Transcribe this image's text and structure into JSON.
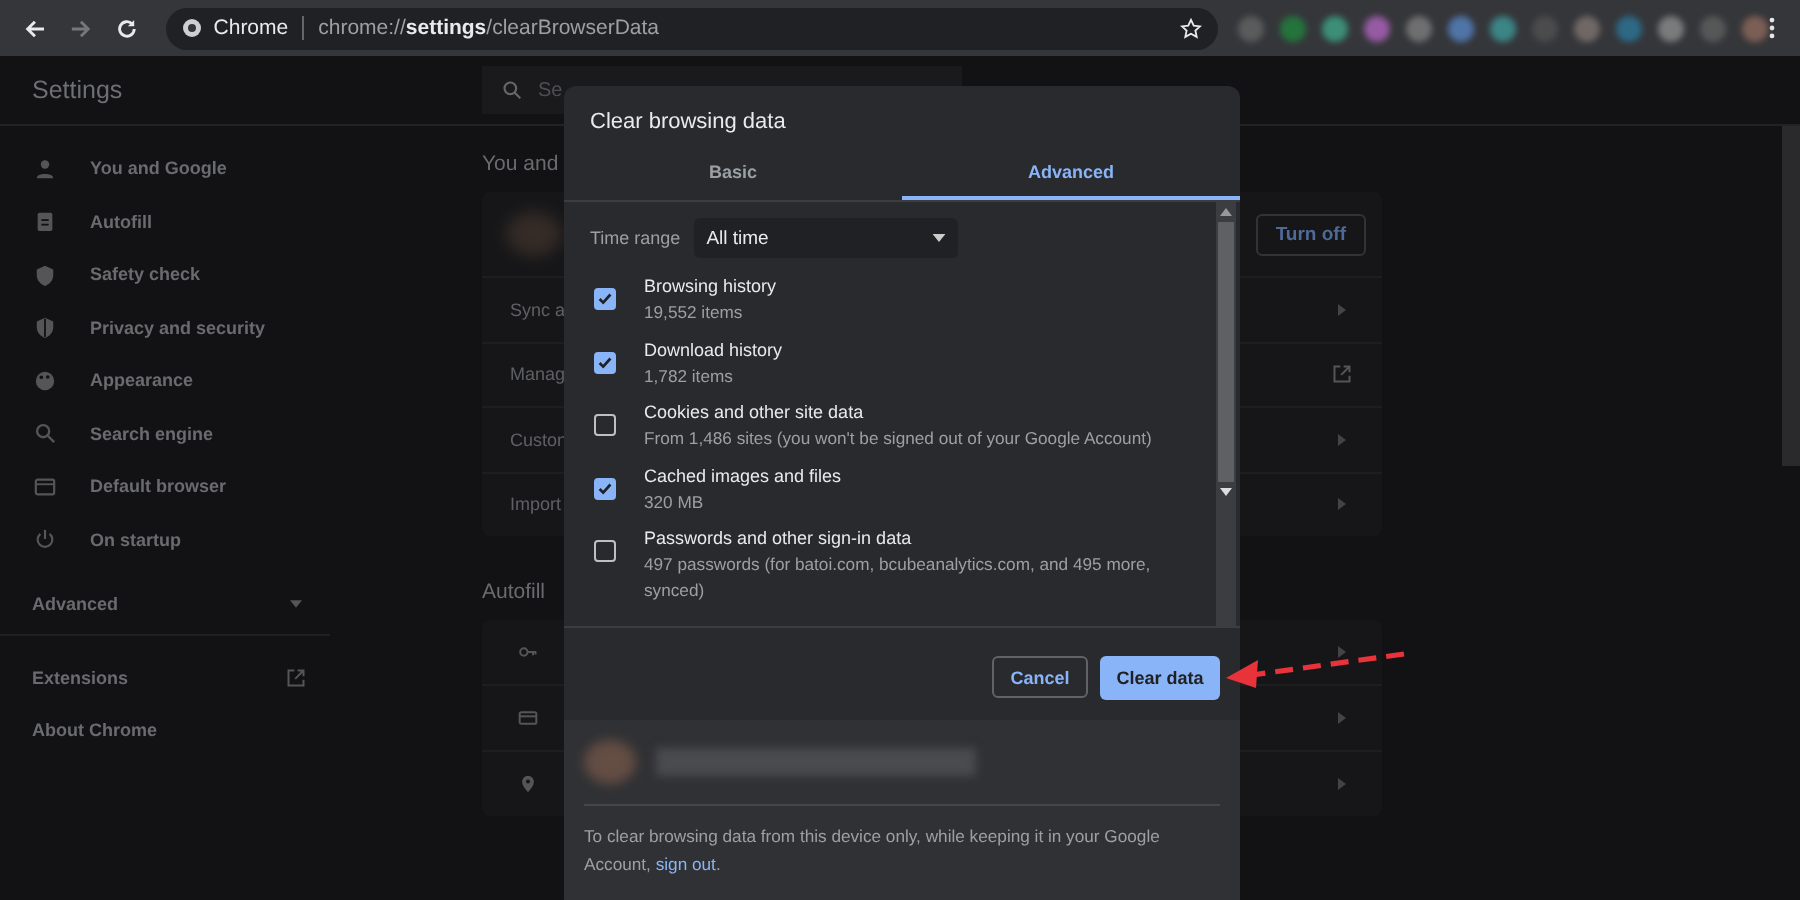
{
  "browser": {
    "site": "Chrome",
    "url": "chrome://**settings**/clearBrowserData"
  },
  "sidebar": {
    "title": "Settings",
    "items": [
      {
        "label": "You and Google",
        "kind": "person"
      },
      {
        "label": "Autofill",
        "kind": "clipboard"
      },
      {
        "label": "Safety check",
        "kind": "shield"
      },
      {
        "label": "Privacy and security",
        "kind": "lock-shield"
      },
      {
        "label": "Appearance",
        "kind": "palette"
      },
      {
        "label": "Search engine",
        "kind": "search"
      },
      {
        "label": "Default browser",
        "kind": "browser"
      },
      {
        "label": "On startup",
        "kind": "power"
      }
    ],
    "advanced": {
      "label": "Advanced",
      "expanded": false
    },
    "links": [
      {
        "label": "Extensions",
        "external": true
      },
      {
        "label": "About Chrome",
        "external": false
      }
    ]
  },
  "search": {
    "placeholder": "Se"
  },
  "main": {
    "heading": "You and",
    "turn_off": "Turn off",
    "rows": [
      {
        "label": "Sync a",
        "kind": "arrow"
      },
      {
        "label": "Manag",
        "kind": "external"
      },
      {
        "label": "Custon",
        "kind": "arrow"
      },
      {
        "label": "Import",
        "kind": "arrow"
      }
    ],
    "autofill_heading": "Autofill",
    "autofill_rows": [
      {
        "kind": "key"
      },
      {
        "kind": "card"
      },
      {
        "kind": "pin"
      }
    ]
  },
  "dialog": {
    "title": "Clear browsing data",
    "tabs": [
      {
        "label": "Basic",
        "selected": false
      },
      {
        "label": "Advanced",
        "selected": true
      }
    ],
    "time_range": {
      "label": "Time range",
      "value": "All time"
    },
    "options": [
      {
        "title": "Browsing history",
        "detail": "19,552 items",
        "checked": true
      },
      {
        "title": "Download history",
        "detail": "1,782 items",
        "checked": true
      },
      {
        "title": "Cookies and other site data",
        "detail": "From 1,486 sites (you won't be signed out of your Google Account)",
        "checked": false
      },
      {
        "title": "Cached images and files",
        "detail": "320 MB",
        "checked": true
      },
      {
        "title": "Passwords and other sign-in data",
        "detail": "497 passwords (for batoi.com, bcubeanalytics.com, and 495 more, synced)",
        "checked": false
      }
    ],
    "cancel": "Cancel",
    "confirm": "Clear data",
    "footer": {
      "text": "To clear browsing data from this device only, while keeping it in your Google Account,",
      "link": "sign out",
      "end": "."
    }
  }
}
